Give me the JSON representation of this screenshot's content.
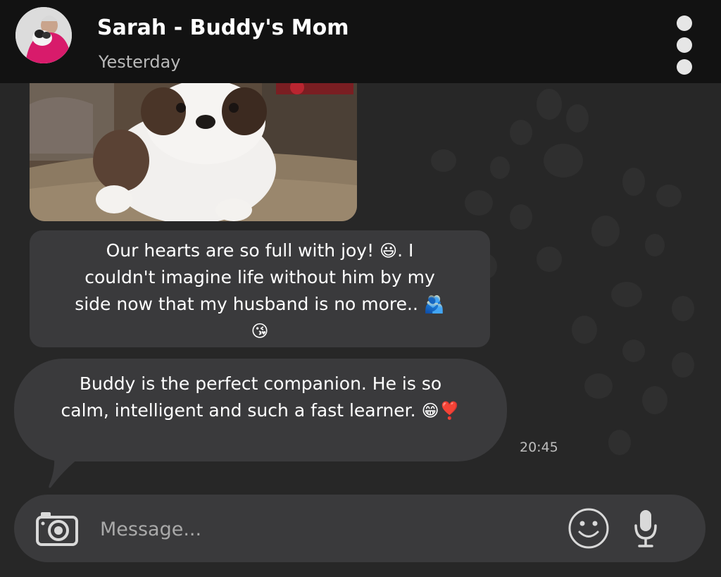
{
  "header": {
    "contact_name": "Sarah - Buddy's Mom",
    "last_seen": "Yesterday",
    "avatar_icon": "contact-avatar",
    "menu_icon": "more-vertical-icon"
  },
  "messages": [
    {
      "type": "image",
      "description_icon": "puppy-photo"
    },
    {
      "type": "text",
      "parts": [
        "Our hearts are so full with joy! ",
        "😃",
        ". I couldn't imagine life without him by my side now that my husband is no more.. ",
        "🫂😘"
      ]
    },
    {
      "type": "text",
      "parts": [
        "Buddy is the perfect companion. He is so calm, intelligent and such a fast learner. ",
        "😁❣️"
      ],
      "time": "20:45"
    }
  ],
  "composer": {
    "placeholder": "Message...",
    "camera_icon": "camera-icon",
    "emoji_icon": "emoji-icon",
    "mic_icon": "microphone-icon"
  },
  "colors": {
    "background": "#272727",
    "header": "#121212",
    "bubble": "#3a3a3c",
    "text": "#ffffff",
    "muted_text": "#b8b8b8"
  }
}
